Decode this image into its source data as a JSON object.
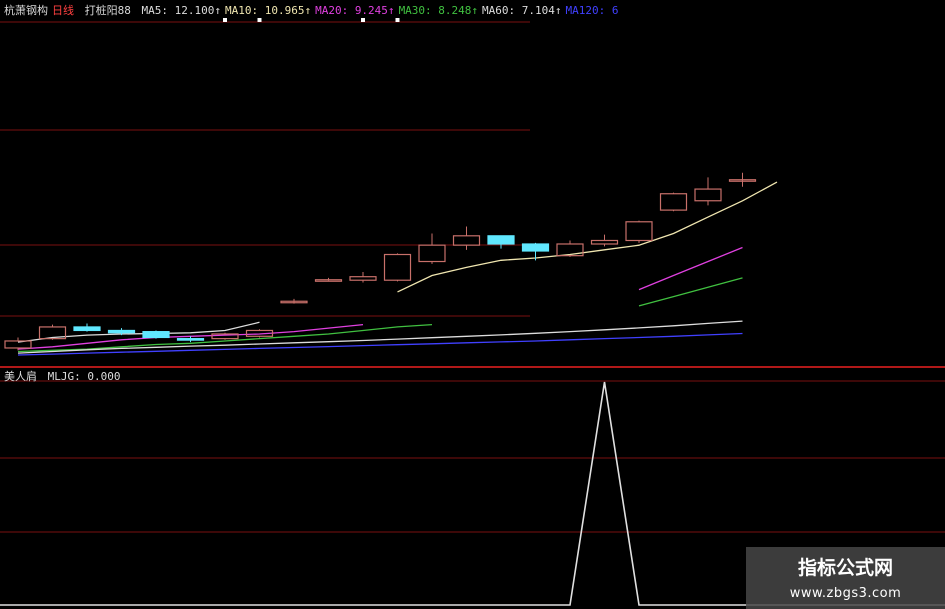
{
  "header": {
    "stock": "杭萧钢构",
    "period": "日线",
    "formula": "打桩阳88",
    "ma_labels": [
      {
        "text": "MA5: 12.100↑",
        "color": "#dddddd"
      },
      {
        "text": "MA10: 10.965↑",
        "color": "#f0e6b0"
      },
      {
        "text": "MA20: 9.245↑",
        "color": "#e040e0"
      },
      {
        "text": "MA30: 8.248↑",
        "color": "#40c040"
      },
      {
        "text": "MA60: 7.104↑",
        "color": "#dddddd"
      },
      {
        "text": "MA120: 6",
        "color": "#4040ff"
      }
    ]
  },
  "indicator": {
    "name": "美人肩",
    "value_label": "MLJG: 0.000"
  },
  "watermark": {
    "title": "指标公式网",
    "url": "www.zbgs3.com"
  },
  "colors": {
    "up": "#c8706a",
    "down": "#60e8ff",
    "grid": "#7a1010",
    "separator": "#b01818",
    "stock_name": "#d8d8d8",
    "period": "#ff4040",
    "formula": "#d8d8d8",
    "indicator_name": "#dddddd",
    "indicator_value": "#dddddd"
  },
  "chart_data": {
    "type": "candlestick",
    "price_range": [
      4.5,
      14.0
    ],
    "candles": [
      {
        "o": 5.1,
        "c": 5.4,
        "h": 5.55,
        "l": 5.0
      },
      {
        "o": 5.5,
        "c": 6.0,
        "h": 6.1,
        "l": 5.45
      },
      {
        "o": 6.0,
        "c": 5.85,
        "h": 6.15,
        "l": 5.8
      },
      {
        "o": 5.85,
        "c": 5.75,
        "h": 5.95,
        "l": 5.65
      },
      {
        "o": 5.8,
        "c": 5.55,
        "h": 5.85,
        "l": 5.5
      },
      {
        "o": 5.5,
        "c": 5.45,
        "h": 5.6,
        "l": 5.35
      },
      {
        "o": 5.5,
        "c": 5.7,
        "h": 5.75,
        "l": 5.45
      },
      {
        "o": 5.6,
        "c": 5.85,
        "h": 5.9,
        "l": 5.55
      },
      {
        "o": 7.1,
        "c": 7.1,
        "h": 7.2,
        "l": 7.0
      },
      {
        "o": 8.0,
        "c": 8.02,
        "h": 8.1,
        "l": 7.95
      },
      {
        "o": 8.0,
        "c": 8.15,
        "h": 8.35,
        "l": 7.9
      },
      {
        "o": 8.0,
        "c": 9.1,
        "h": 9.15,
        "l": 7.95
      },
      {
        "o": 8.8,
        "c": 9.5,
        "h": 10.0,
        "l": 8.7
      },
      {
        "o": 9.5,
        "c": 9.9,
        "h": 10.3,
        "l": 9.3
      },
      {
        "o": 9.9,
        "c": 9.55,
        "h": 9.9,
        "l": 9.35
      },
      {
        "o": 9.55,
        "c": 9.25,
        "h": 9.6,
        "l": 8.85
      },
      {
        "o": 9.05,
        "c": 9.55,
        "h": 9.7,
        "l": 9.0
      },
      {
        "o": 9.55,
        "c": 9.7,
        "h": 9.95,
        "l": 9.45
      },
      {
        "o": 9.7,
        "c": 10.5,
        "h": 10.55,
        "l": 9.6
      },
      {
        "o": 11.0,
        "c": 11.7,
        "h": 11.75,
        "l": 10.95
      },
      {
        "o": 11.4,
        "c": 11.9,
        "h": 12.4,
        "l": 11.2
      },
      {
        "o": 12.3,
        "c": 12.3,
        "h": 12.6,
        "l": 12.0
      }
    ],
    "ma_series": [
      {
        "name": "MA5",
        "color": "#dddddd",
        "start": 0,
        "values": [
          5.35,
          5.55,
          5.65,
          5.7,
          5.72,
          5.75,
          5.85,
          6.2
        ]
      },
      {
        "name": "MA10",
        "color": "#f0e6b0",
        "start": 11,
        "values": [
          7.5,
          8.2,
          8.55,
          8.85,
          8.95,
          9.1,
          9.3,
          9.5,
          10.0,
          10.7,
          11.4,
          12.2
        ]
      },
      {
        "name": "MA20",
        "color": "#e040e0",
        "start": 0,
        "values": [
          5.05,
          5.15,
          5.3,
          5.45,
          5.55,
          5.6,
          5.65,
          5.7,
          5.8,
          5.95,
          6.1
        ]
      },
      {
        "name": "MA20",
        "color": "#e040e0",
        "start": 18,
        "values": [
          7.6,
          8.2,
          8.8,
          9.4
        ]
      },
      {
        "name": "MA30",
        "color": "#40c040",
        "start": 0,
        "values": [
          4.95,
          5.0,
          5.05,
          5.15,
          5.25,
          5.3,
          5.4,
          5.5,
          5.6,
          5.7,
          5.85,
          6.0,
          6.1
        ]
      },
      {
        "name": "MA30",
        "color": "#40c040",
        "start": 18,
        "values": [
          6.9,
          7.3,
          7.7,
          8.1
        ]
      },
      {
        "name": "MA60",
        "color": "#dddddd",
        "start": 0,
        "values": [
          4.88,
          4.95,
          5.02,
          5.08,
          5.13,
          5.18,
          5.22,
          5.27,
          5.32,
          5.37,
          5.42,
          5.48,
          5.54,
          5.6,
          5.66,
          5.73,
          5.8,
          5.88,
          5.96,
          6.05,
          6.15,
          6.25
        ]
      },
      {
        "name": "MA120",
        "color": "#4040ff",
        "start": 0,
        "values": [
          4.8,
          4.84,
          4.88,
          4.92,
          4.96,
          5.0,
          5.04,
          5.08,
          5.12,
          5.16,
          5.2,
          5.24,
          5.28,
          5.32,
          5.36,
          5.4,
          5.45,
          5.5,
          5.55,
          5.6,
          5.66,
          5.72
        ]
      }
    ],
    "indicator_series": {
      "name": "MLJG",
      "range": [
        0,
        1
      ],
      "values": [
        0,
        0,
        0,
        0,
        0,
        0,
        0,
        0,
        0,
        0,
        0,
        0,
        0,
        0,
        0,
        0,
        0,
        1,
        0,
        0,
        0,
        0
      ]
    },
    "markers": [
      6,
      7,
      10,
      11
    ]
  }
}
